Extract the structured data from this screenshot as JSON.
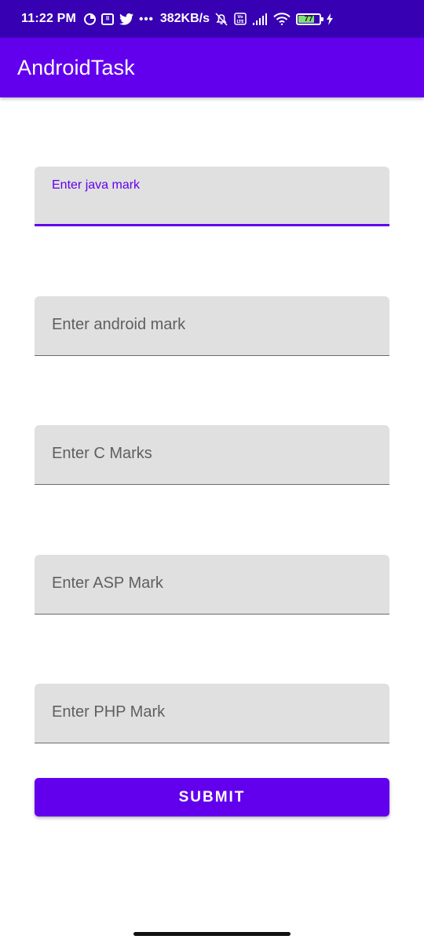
{
  "status_bar": {
    "time": "11:22 PM",
    "network_speed": "382KB/s",
    "battery_level": "77",
    "battery_fraction": 0.77,
    "icons": [
      "circle-status-icon",
      "grid-app-icon",
      "twitter-icon",
      "more-dots-icon",
      "mute-icon",
      "volte-icon",
      "signal-icon",
      "wifi-icon",
      "battery-icon",
      "charging-icon"
    ]
  },
  "app_bar": {
    "title": "AndroidTask"
  },
  "form": {
    "java": {
      "label": "Enter java mark",
      "value": ""
    },
    "android": {
      "placeholder": "Enter android mark",
      "value": ""
    },
    "c": {
      "placeholder": "Enter C Marks",
      "value": ""
    },
    "asp": {
      "placeholder": "Enter ASP Mark",
      "value": ""
    },
    "php": {
      "placeholder": "Enter PHP Mark",
      "value": ""
    },
    "submit_label": "SUBMIT"
  },
  "colors": {
    "status_bar": "#3700B3",
    "primary": "#6200EE",
    "field_background": "#E0E0E0",
    "battery": "#7FE07A"
  }
}
